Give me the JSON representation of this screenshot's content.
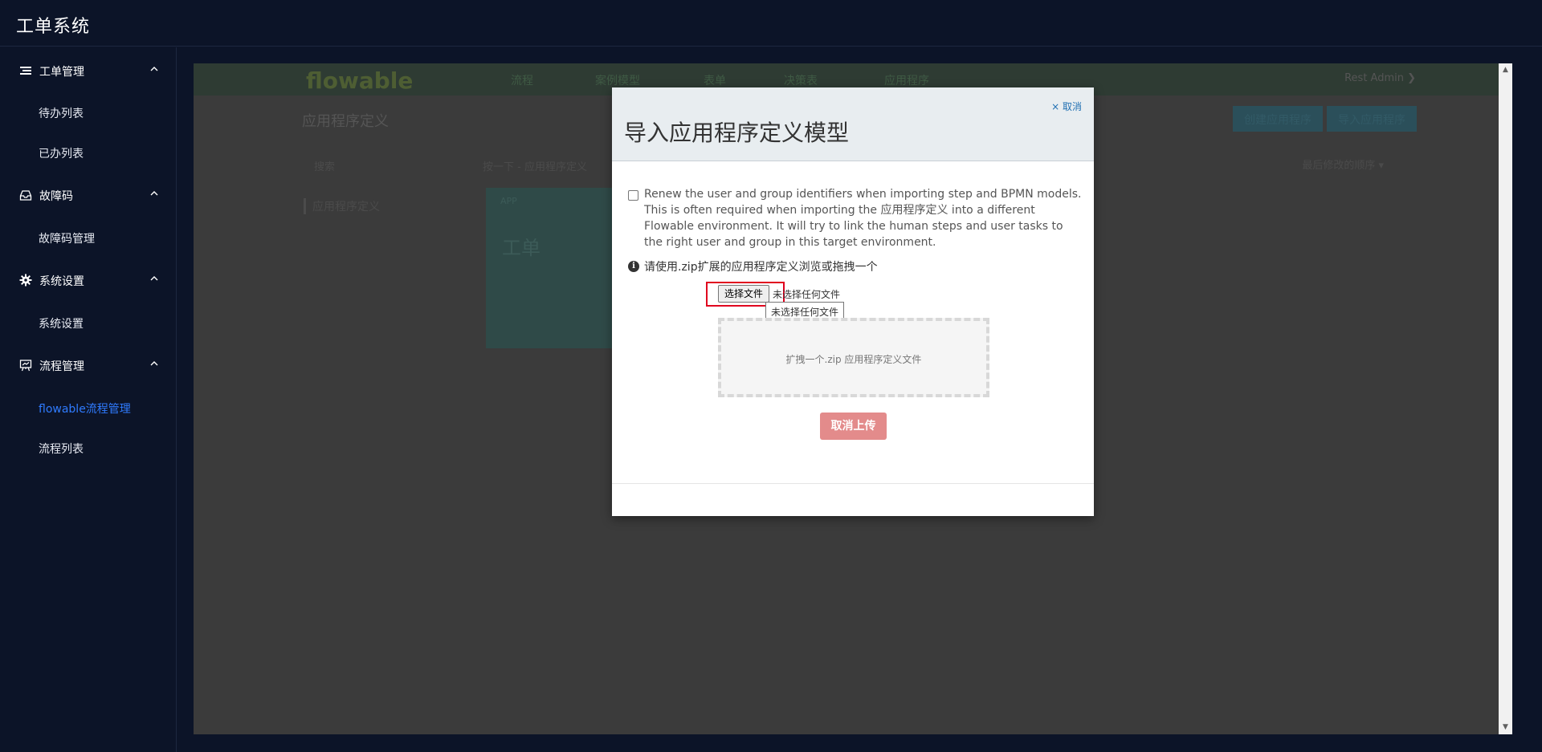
{
  "app": {
    "title": "工单系统"
  },
  "sidebar": {
    "groups": [
      {
        "label": "工单管理",
        "icon": "list-icon",
        "items": [
          "待办列表",
          "已办列表"
        ]
      },
      {
        "label": "故障码",
        "icon": "inbox-icon",
        "items": [
          "故障码管理"
        ]
      },
      {
        "label": "系统设置",
        "icon": "gear-icon",
        "items": [
          "系统设置"
        ]
      },
      {
        "label": "流程管理",
        "icon": "board-icon",
        "items": [
          "flowable流程管理",
          "流程列表"
        ]
      }
    ],
    "active_item": "flowable流程管理",
    "active_color": "#2f7bff"
  },
  "background_app": {
    "logo": "flowable",
    "nav": [
      "流程",
      "案例模型",
      "表单",
      "决策表",
      "应用程序"
    ],
    "user": "Rest Admin ❯",
    "page_title": "应用程序定义",
    "buttons": [
      "创建应用程序",
      "导入应用程序"
    ],
    "search_placeholder": "搜索",
    "filter": "按一下 - 应用程序定义",
    "sort": "最后修改的顺序 ▾",
    "side_label": "应用程序定义",
    "card_badge": "APP",
    "card_title": "工单"
  },
  "modal": {
    "title": "导入应用程序定义模型",
    "close": "× 取消",
    "renew_option": "Renew the user and group identifiers when importing step and BPMN models. This is often required when importing the 应用程序定义 into a different Flowable environment. It will try to link the human steps and user tasks to the right user and group in this target environment.",
    "renew_checked": false,
    "info": "请使用.zip扩展的应用程序定义浏览或拖拽一个",
    "file_button": "选择文件",
    "file_status": "未选择任何文件",
    "tooltip": "未选择任何文件",
    "dropzone": "扩拽一个.zip 应用程序定义文件",
    "cancel_upload": "取消上传",
    "highlight_color": "#e0001e"
  }
}
